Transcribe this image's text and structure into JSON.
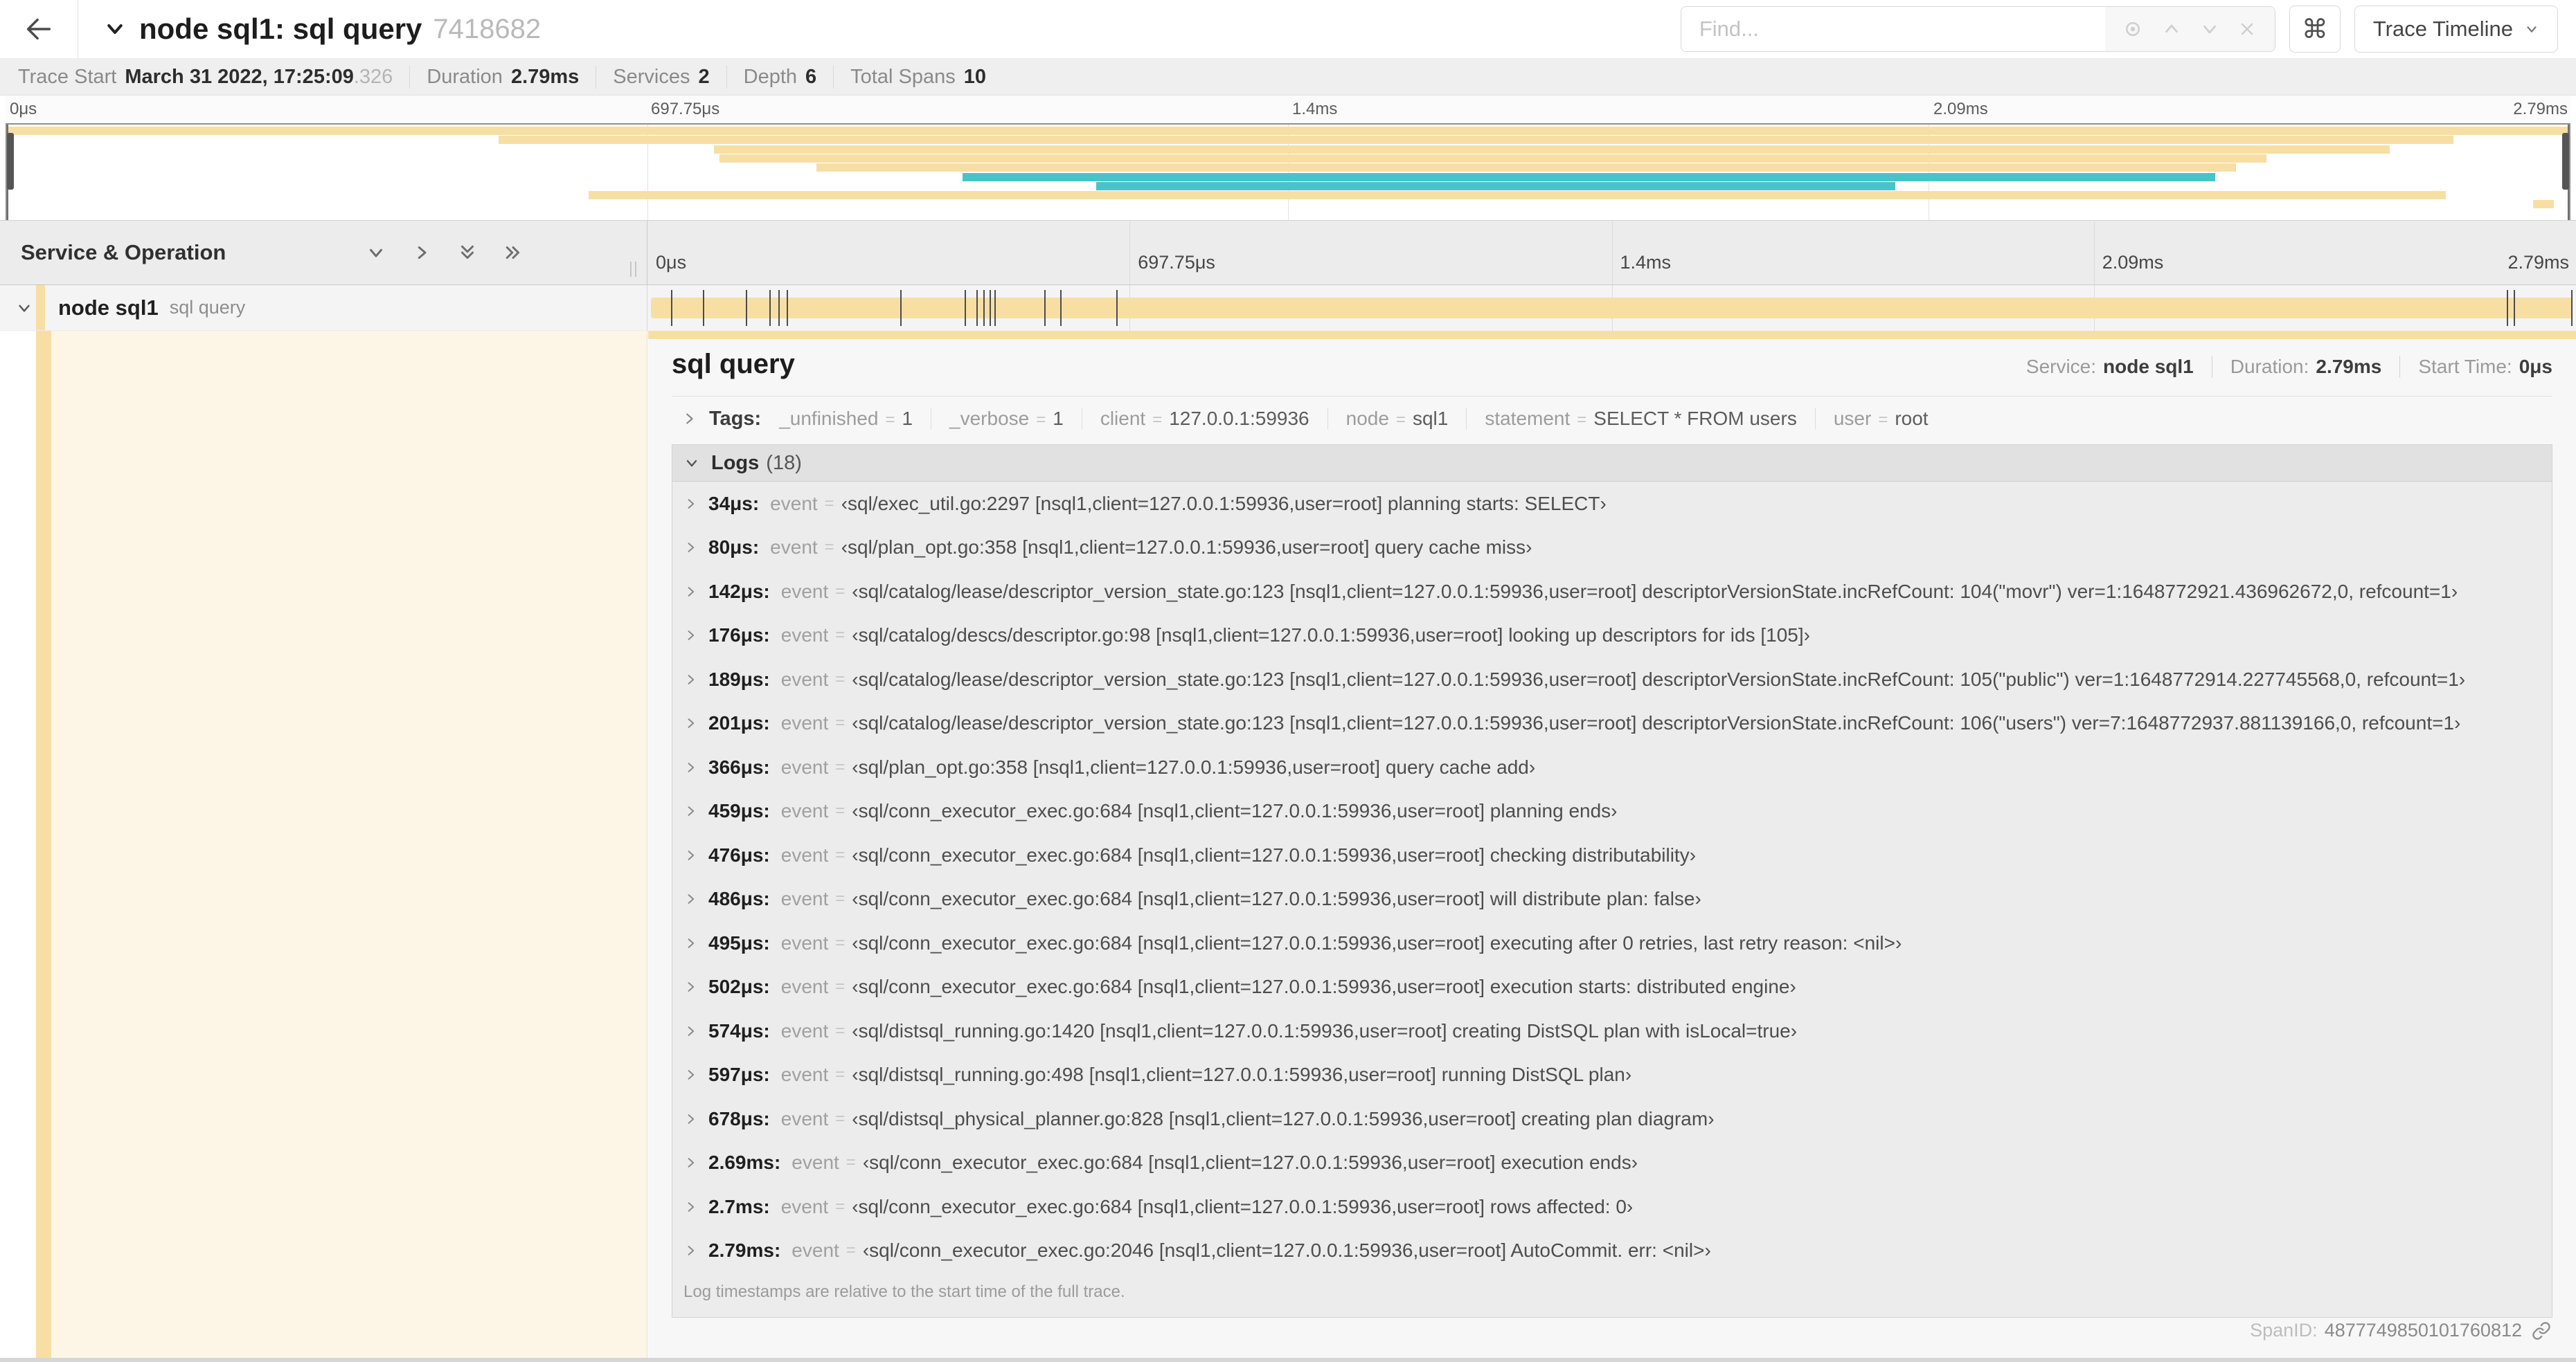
{
  "header": {
    "title": "node sql1: sql query",
    "trace_id": "7418682",
    "find": {
      "placeholder": "Find..."
    },
    "shortcut_button": "⌘",
    "view_dropdown": "Trace Timeline"
  },
  "summary": {
    "items": [
      {
        "label": "Trace Start",
        "value": "March 31 2022, 17:25:09",
        "muted": ".326"
      },
      {
        "label": "Duration",
        "value": "2.79ms"
      },
      {
        "label": "Services",
        "value": "2"
      },
      {
        "label": "Depth",
        "value": "6"
      },
      {
        "label": "Total Spans",
        "value": "10"
      }
    ]
  },
  "timeline": {
    "left_header": "Service & Operation",
    "ticks": [
      {
        "label": "0μs",
        "pct": 0
      },
      {
        "label": "697.75μs",
        "pct": 25
      },
      {
        "label": "1.4ms",
        "pct": 50
      },
      {
        "label": "2.09ms",
        "pct": 75
      },
      {
        "label": "2.79ms",
        "pct": 100
      }
    ],
    "colors": {
      "tan": "#f7dfa4",
      "teal": "#48c4c9"
    },
    "minimap_bars": [
      {
        "row": 0,
        "start": 0,
        "end": 100,
        "color": "tan"
      },
      {
        "row": 1,
        "start": 19.2,
        "end": 95.5,
        "color": "tan"
      },
      {
        "row": 2,
        "start": 27.6,
        "end": 93.0,
        "color": "tan"
      },
      {
        "row": 3,
        "start": 27.8,
        "end": 88.2,
        "color": "tan"
      },
      {
        "row": 4,
        "start": 31.6,
        "end": 87.0,
        "color": "tan"
      },
      {
        "row": 5,
        "start": 37.3,
        "end": 86.2,
        "color": "teal"
      },
      {
        "row": 6,
        "start": 42.5,
        "end": 73.7,
        "color": "teal"
      },
      {
        "row": 7,
        "start": 22.7,
        "end": 95.2,
        "color": "tan"
      },
      {
        "row": 8,
        "start": 98.6,
        "end": 99.4,
        "color": "tan"
      }
    ]
  },
  "span_row": {
    "service": "node sql1",
    "operation": "sql query",
    "event_pcts": [
      1.22,
      2.87,
      5.09,
      6.31,
      6.77,
      7.2,
      13.12,
      16.45,
      17.06,
      17.42,
      17.74,
      18.0,
      20.57,
      21.4,
      24.3,
      96.42,
      96.77,
      100
    ]
  },
  "detail": {
    "title": "sql query",
    "meta": [
      {
        "label": "Service:",
        "value": "node sql1"
      },
      {
        "label": "Duration:",
        "value": "2.79ms"
      },
      {
        "label": "Start Time:",
        "value": "0μs"
      }
    ],
    "tags_label": "Tags:",
    "tags": [
      {
        "key": "_unfinished",
        "value": "1"
      },
      {
        "key": "_verbose",
        "value": "1"
      },
      {
        "key": "client",
        "value": "127.0.0.1:59936"
      },
      {
        "key": "node",
        "value": "sql1"
      },
      {
        "key": "statement",
        "value": "SELECT * FROM users"
      },
      {
        "key": "user",
        "value": "root"
      }
    ],
    "logs_header": "Logs",
    "logs_count": "(18)",
    "logs": [
      {
        "time": "34μs:",
        "key": "event",
        "value": "‹sql/exec_util.go:2297 [nsql1,client=127.0.0.1:59936,user=root] planning starts: SELECT›"
      },
      {
        "time": "80μs:",
        "key": "event",
        "value": "‹sql/plan_opt.go:358 [nsql1,client=127.0.0.1:59936,user=root] query cache miss›"
      },
      {
        "time": "142μs:",
        "key": "event",
        "value": "‹sql/catalog/lease/descriptor_version_state.go:123 [nsql1,client=127.0.0.1:59936,user=root] descriptorVersionState.incRefCount: 104(\"movr\") ver=1:1648772921.436962672,0, refcount=1›"
      },
      {
        "time": "176μs:",
        "key": "event",
        "value": "‹sql/catalog/descs/descriptor.go:98 [nsql1,client=127.0.0.1:59936,user=root] looking up descriptors for ids [105]›"
      },
      {
        "time": "189μs:",
        "key": "event",
        "value": "‹sql/catalog/lease/descriptor_version_state.go:123 [nsql1,client=127.0.0.1:59936,user=root] descriptorVersionState.incRefCount: 105(\"public\") ver=1:1648772914.227745568,0, refcount=1›"
      },
      {
        "time": "201μs:",
        "key": "event",
        "value": "‹sql/catalog/lease/descriptor_version_state.go:123 [nsql1,client=127.0.0.1:59936,user=root] descriptorVersionState.incRefCount: 106(\"users\") ver=7:1648772937.881139166,0, refcount=1›"
      },
      {
        "time": "366μs:",
        "key": "event",
        "value": "‹sql/plan_opt.go:358 [nsql1,client=127.0.0.1:59936,user=root] query cache add›"
      },
      {
        "time": "459μs:",
        "key": "event",
        "value": "‹sql/conn_executor_exec.go:684 [nsql1,client=127.0.0.1:59936,user=root] planning ends›"
      },
      {
        "time": "476μs:",
        "key": "event",
        "value": "‹sql/conn_executor_exec.go:684 [nsql1,client=127.0.0.1:59936,user=root] checking distributability›"
      },
      {
        "time": "486μs:",
        "key": "event",
        "value": "‹sql/conn_executor_exec.go:684 [nsql1,client=127.0.0.1:59936,user=root] will distribute plan: false›"
      },
      {
        "time": "495μs:",
        "key": "event",
        "value": "‹sql/conn_executor_exec.go:684 [nsql1,client=127.0.0.1:59936,user=root] executing after 0 retries, last retry reason: <nil>›"
      },
      {
        "time": "502μs:",
        "key": "event",
        "value": "‹sql/conn_executor_exec.go:684 [nsql1,client=127.0.0.1:59936,user=root] execution starts: distributed engine›"
      },
      {
        "time": "574μs:",
        "key": "event",
        "value": "‹sql/distsql_running.go:1420 [nsql1,client=127.0.0.1:59936,user=root] creating DistSQL plan with isLocal=true›"
      },
      {
        "time": "597μs:",
        "key": "event",
        "value": "‹sql/distsql_running.go:498 [nsql1,client=127.0.0.1:59936,user=root] running DistSQL plan›"
      },
      {
        "time": "678μs:",
        "key": "event",
        "value": "‹sql/distsql_physical_planner.go:828 [nsql1,client=127.0.0.1:59936,user=root] creating plan diagram›"
      },
      {
        "time": "2.69ms:",
        "key": "event",
        "value": "‹sql/conn_executor_exec.go:684 [nsql1,client=127.0.0.1:59936,user=root] execution ends›"
      },
      {
        "time": "2.7ms:",
        "key": "event",
        "value": "‹sql/conn_executor_exec.go:684 [nsql1,client=127.0.0.1:59936,user=root] rows affected: 0›"
      },
      {
        "time": "2.79ms:",
        "key": "event",
        "value": "‹sql/conn_executor_exec.go:2046 [nsql1,client=127.0.0.1:59936,user=root] AutoCommit. err: <nil>›"
      }
    ],
    "logs_note": "Log timestamps are relative to the start time of the full trace.",
    "span_id_label": "SpanID:",
    "span_id": "4877749850101760812"
  }
}
